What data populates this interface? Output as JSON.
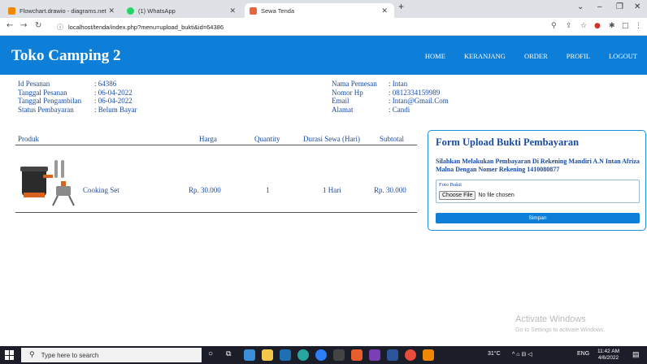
{
  "browser": {
    "tabs": [
      {
        "title": "Flowchart.drawio - diagrams.net",
        "active": false,
        "color": "#f08705"
      },
      {
        "title": "(1) WhatsApp",
        "active": false,
        "color": "#25d366"
      },
      {
        "title": "Sewa Tenda",
        "active": true,
        "color": "#e8663d"
      }
    ],
    "new_tab": "+",
    "url": "localhost/tenda/index.php?menu=upload_bukti&id=64386"
  },
  "site": {
    "title": "Toko Camping 2",
    "nav": [
      "HOME",
      "KERANJANG",
      "ORDER",
      "PROFIL",
      "LOGOUT"
    ]
  },
  "order_info": {
    "left": [
      {
        "label": "Id Pesanan",
        "value": ": 64386"
      },
      {
        "label": "Tanggal Pesanan",
        "value": ": 06-04-2022"
      },
      {
        "label": "Tanggal Pengambilan",
        "value": ": 06-04-2022"
      },
      {
        "label": "Status Pembayaran",
        "value": ": Belum Bayar"
      }
    ],
    "right": [
      {
        "label": "Nama Pemesan",
        "value": ": Intan"
      },
      {
        "label": "Nomor Hp",
        "value": ": 0812334159989"
      },
      {
        "label": "Email",
        "value": ": Intan@Gmail.Com"
      },
      {
        "label": "Alamat",
        "value": ": Candi"
      }
    ]
  },
  "table": {
    "headers": [
      "Produk",
      "Harga",
      "Quantity",
      "Durasi Sewa (Hari)",
      "Subtotal"
    ],
    "rows": [
      {
        "product": "Cooking Set",
        "price": "Rp. 30.000",
        "qty": "1",
        "duration": "1 Hari",
        "subtotal": "Rp. 30.000"
      }
    ]
  },
  "form": {
    "title": "Form Upload Bukti Pembayaran",
    "description": "Silahkan Melakukan Pembayaran Di Rekening Mandiri A.N Intan Afriza Malna Dengan Nomer Rekening 1410080877",
    "file_label": "Foto Bukti",
    "file_button": "Choose File",
    "file_status": "No file chosen",
    "submit": "Simpan"
  },
  "watermark": {
    "title": "Activate Windows",
    "subtitle": "Go to Settings to activate Windows."
  },
  "taskbar": {
    "search_placeholder": "Type here to search",
    "weather": "31°C",
    "lang": "ENG",
    "time": "11:42 AM",
    "date": "4/6/2022"
  }
}
